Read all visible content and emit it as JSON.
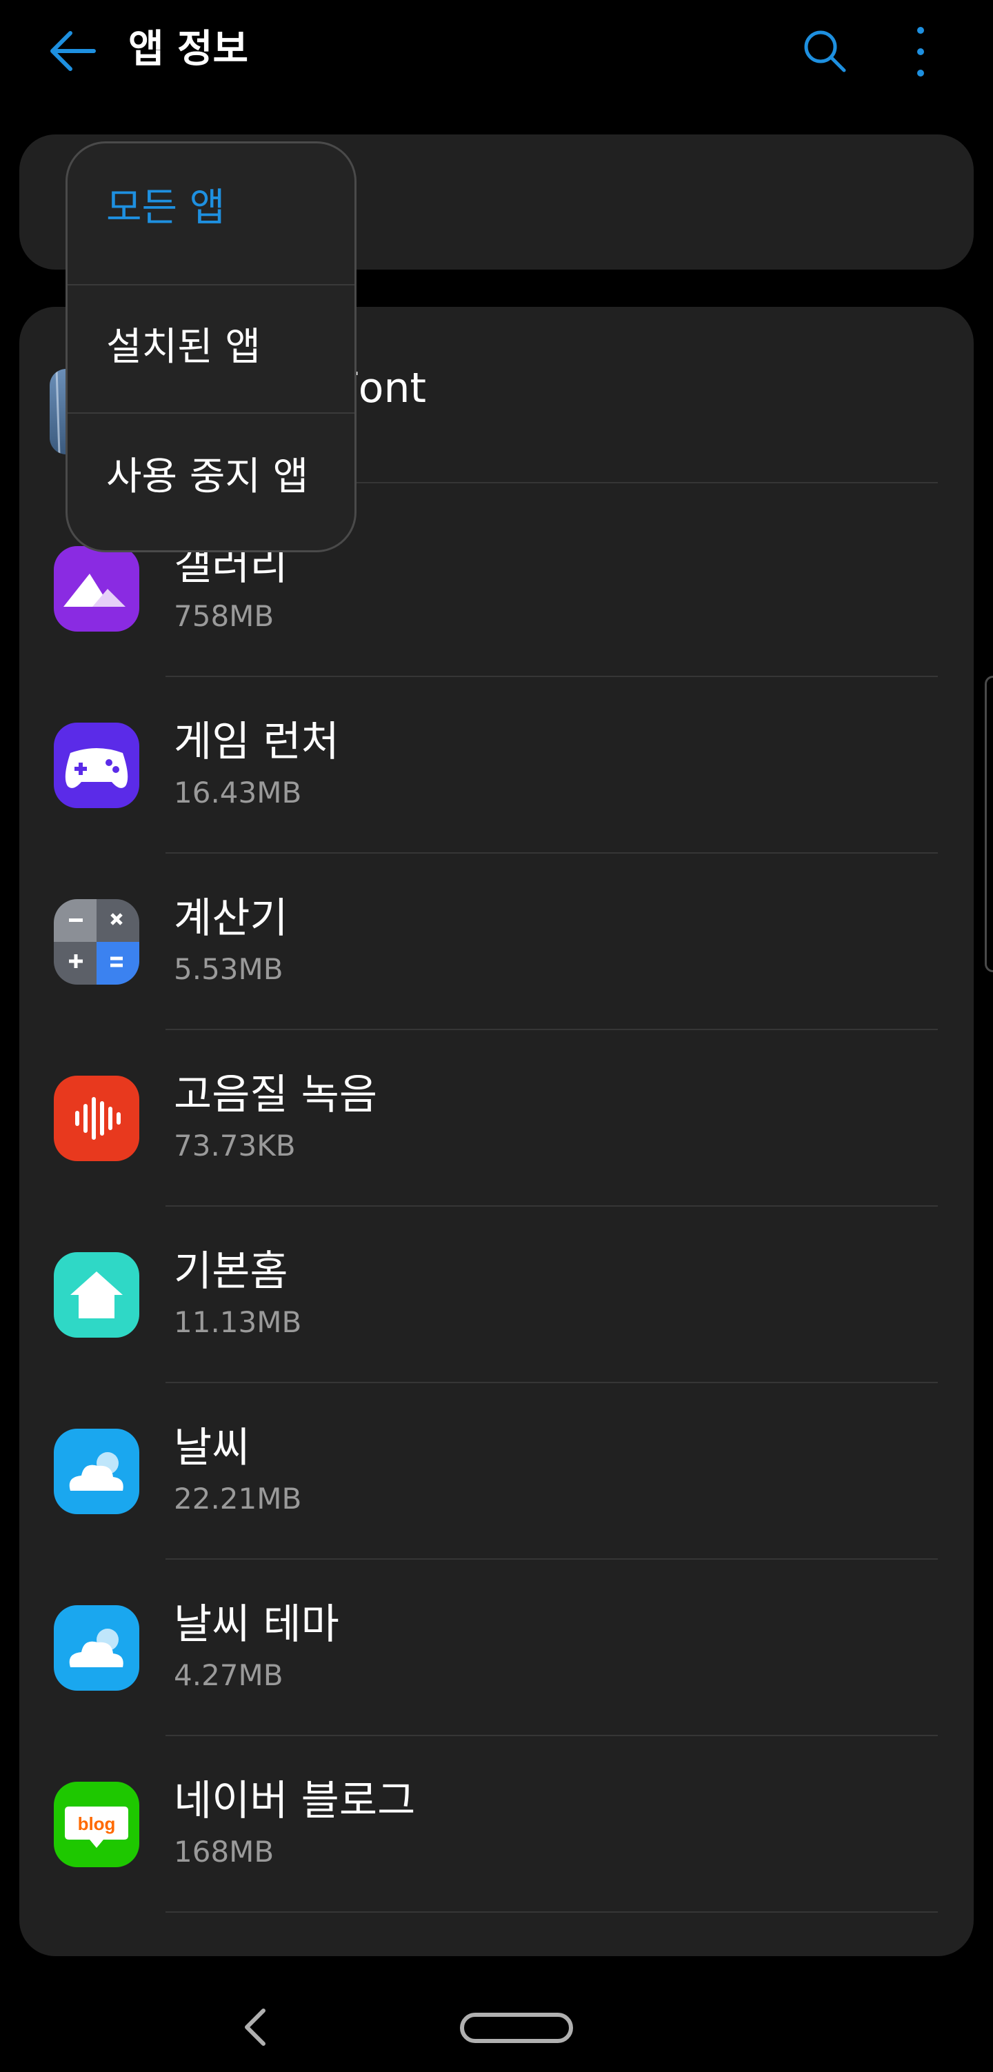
{
  "header": {
    "title": "앱 정보"
  },
  "filter_menu": {
    "options": [
      "모든 앱",
      "설치된 앱",
      "사용 중지 앱"
    ],
    "selected": "모든 앱"
  },
  "apps": [
    {
      "name": "비오는날 FlipFont",
      "name_visible": "는날 FlipFont",
      "size": ""
    },
    {
      "name": "갤러리",
      "size": "758MB"
    },
    {
      "name": "게임 런처",
      "size": "16.43MB"
    },
    {
      "name": "계산기",
      "size": "5.53MB"
    },
    {
      "name": "고음질 녹음",
      "size": "73.73KB"
    },
    {
      "name": "기본홈",
      "size": "11.13MB"
    },
    {
      "name": "날씨",
      "size": "22.21MB"
    },
    {
      "name": "날씨 테마",
      "size": "4.27MB"
    },
    {
      "name": "네이버 블로그",
      "size": "168MB"
    }
  ],
  "colors": {
    "accent": "#1e90e0",
    "background": "#000000",
    "card": "#212121",
    "secondary_text": "#9a9a9a"
  }
}
